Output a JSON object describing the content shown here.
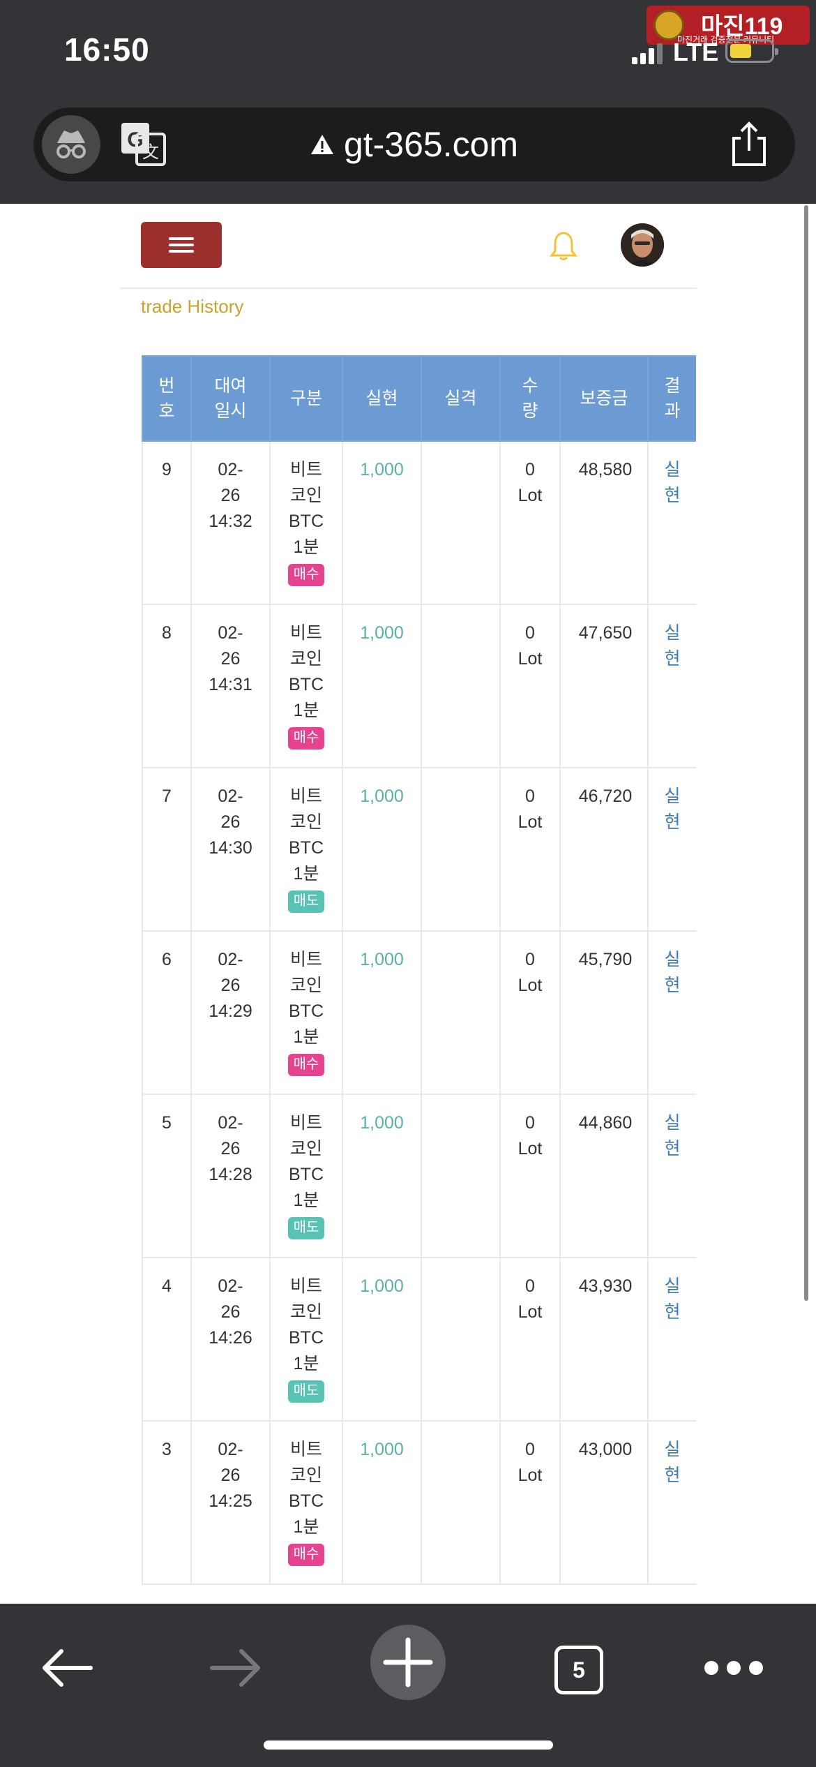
{
  "status_bar": {
    "time": "16:50",
    "network": "LTE",
    "watermark_text": "마진119",
    "watermark_subtext": "마진거래 검증전문 커뮤니티"
  },
  "browser": {
    "url": "gt-365.com",
    "open_tabs": "5"
  },
  "page": {
    "section_title": "trade History",
    "table": {
      "headers": {
        "no": "번\n호",
        "date": "대여\n일시",
        "type": "구분",
        "realized": "실현",
        "lost": "실격",
        "quantity": "수\n량",
        "margin": "보증금",
        "result": "결\n과"
      },
      "rows": [
        {
          "no": "9",
          "date": "02-\n26\n14:32",
          "type": "비트\n코인\nBTC\n1분",
          "side": "매수",
          "side_kind": "buy",
          "realized": "1,000",
          "lost": "",
          "quantity": "0\nLot",
          "margin": "48,580",
          "result": "실\n현"
        },
        {
          "no": "8",
          "date": "02-\n26\n14:31",
          "type": "비트\n코인\nBTC\n1분",
          "side": "매수",
          "side_kind": "buy",
          "realized": "1,000",
          "lost": "",
          "quantity": "0\nLot",
          "margin": "47,650",
          "result": "실\n현"
        },
        {
          "no": "7",
          "date": "02-\n26\n14:30",
          "type": "비트\n코인\nBTC\n1분",
          "side": "매도",
          "side_kind": "sell",
          "realized": "1,000",
          "lost": "",
          "quantity": "0\nLot",
          "margin": "46,720",
          "result": "실\n현"
        },
        {
          "no": "6",
          "date": "02-\n26\n14:29",
          "type": "비트\n코인\nBTC\n1분",
          "side": "매수",
          "side_kind": "buy",
          "realized": "1,000",
          "lost": "",
          "quantity": "0\nLot",
          "margin": "45,790",
          "result": "실\n현"
        },
        {
          "no": "5",
          "date": "02-\n26\n14:28",
          "type": "비트\n코인\nBTC\n1분",
          "side": "매도",
          "side_kind": "sell",
          "realized": "1,000",
          "lost": "",
          "quantity": "0\nLot",
          "margin": "44,860",
          "result": "실\n현"
        },
        {
          "no": "4",
          "date": "02-\n26\n14:26",
          "type": "비트\n코인\nBTC\n1분",
          "side": "매도",
          "side_kind": "sell",
          "realized": "1,000",
          "lost": "",
          "quantity": "0\nLot",
          "margin": "43,930",
          "result": "실\n현"
        },
        {
          "no": "3",
          "date": "02-\n26\n14:25",
          "type": "비트\n코인\nBTC\n1분",
          "side": "매수",
          "side_kind": "buy",
          "realized": "1,000",
          "lost": "",
          "quantity": "0\nLot",
          "margin": "43,000",
          "result": "실\n현"
        }
      ]
    }
  },
  "colors": {
    "chrome_dark": "#333437",
    "menu_button": "#9d2f2c",
    "table_header": "#6b9bd2",
    "title_gold": "#c6a22e",
    "bell_yellow": "#f3c333",
    "buy_badge": "#e5438f",
    "sell_badge": "#58c3b4",
    "amount_teal": "#5ab0a8",
    "result_blue": "#3d7ab5"
  },
  "icons": {
    "incognito": "incognito-icon",
    "translate": "translate-icon",
    "warning": "warning-icon",
    "share": "share-icon",
    "menu": "hamburger-icon",
    "bell": "bell-icon",
    "back": "arrow-left-icon",
    "forward": "arrow-right-icon",
    "new_tab": "plus-icon",
    "more": "more-dots-icon"
  }
}
